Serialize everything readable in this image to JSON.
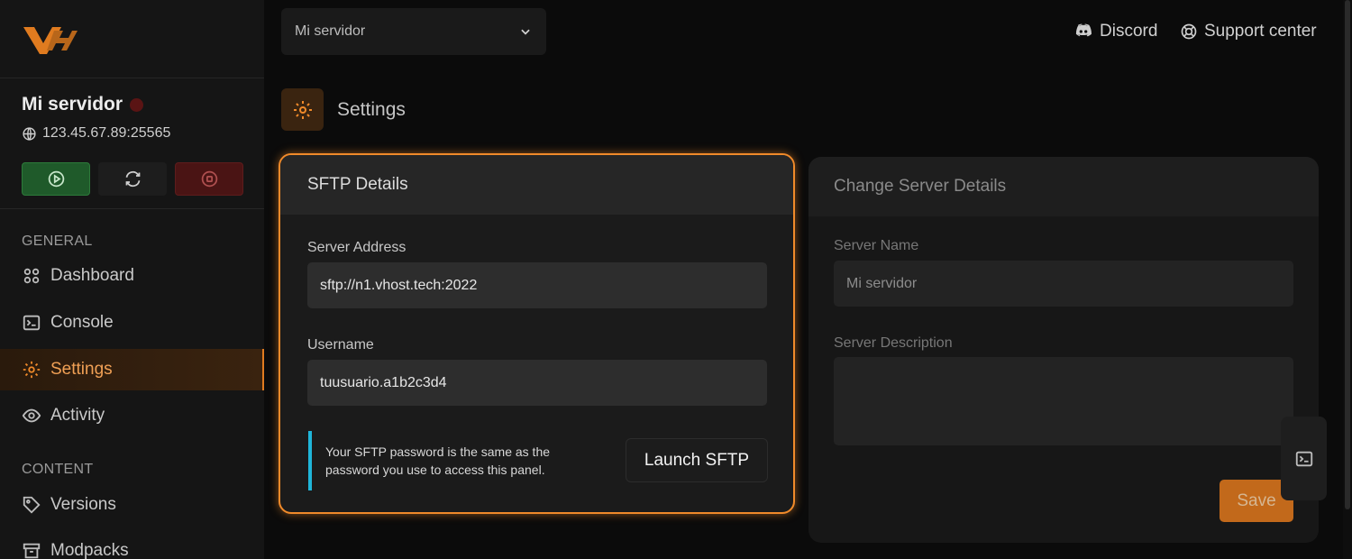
{
  "sidebar": {
    "server_name": "Mi servidor",
    "server_ip": "123.45.67.89:25565",
    "controls": {
      "start_icon": "play-circle-icon",
      "restart_icon": "refresh-icon",
      "stop_icon": "stop-circle-icon"
    },
    "sections": [
      {
        "label": "GENERAL",
        "items": [
          {
            "label": "Dashboard",
            "icon": "grid-icon"
          },
          {
            "label": "Console",
            "icon": "terminal-icon"
          },
          {
            "label": "Settings",
            "icon": "gear-icon",
            "active": true
          },
          {
            "label": "Activity",
            "icon": "eye-icon"
          }
        ]
      },
      {
        "label": "CONTENT",
        "items": [
          {
            "label": "Versions",
            "icon": "tag-icon"
          },
          {
            "label": "Modpacks",
            "icon": "archive-icon"
          }
        ]
      }
    ]
  },
  "topbar": {
    "server_select": "Mi servidor",
    "discord": "Discord",
    "support": "Support center"
  },
  "page": {
    "title": "Settings"
  },
  "sftp": {
    "title": "SFTP Details",
    "address_label": "Server Address",
    "address_value": "sftp://n1.vhost.tech:2022",
    "username_label": "Username",
    "username_value": "tuusuario.a1b2c3d4",
    "info_line1": "Your SFTP password is the same as the",
    "info_line2": "password you use to access this panel.",
    "launch_label": "Launch SFTP"
  },
  "change": {
    "title": "Change Server Details",
    "name_label": "Server Name",
    "name_value": "Mi servidor",
    "desc_label": "Server Description",
    "desc_value": "",
    "save_label": "Save"
  },
  "colors": {
    "accent": "#f08a2a",
    "info": "#1fb5d9",
    "start": "#1f5a2a",
    "stop": "#4a1414"
  }
}
